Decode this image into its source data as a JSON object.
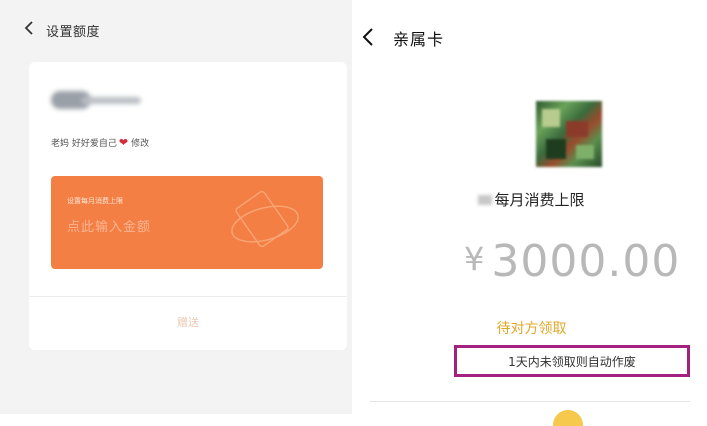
{
  "left": {
    "title": "设置额度",
    "message": "老妈 好好爱自己",
    "edit_label": "修改",
    "card_label": "设置每月消费上限",
    "amount_placeholder": "点此输入金额",
    "send_label": "赠送"
  },
  "right": {
    "title": "亲属卡",
    "limit_label": "每月消费上限",
    "currency_symbol": "¥",
    "amount": "3000.00",
    "status": "待对方领取",
    "notice": "1天内未领取则自动作废"
  },
  "colors": {
    "orange_card": "#f47f45",
    "status": "#e0a82a",
    "highlight_border": "#a3227f"
  },
  "icons": {
    "back": "chevron-left-icon",
    "heart": "heart-icon",
    "card_decoration": "card-orbit-icon"
  }
}
